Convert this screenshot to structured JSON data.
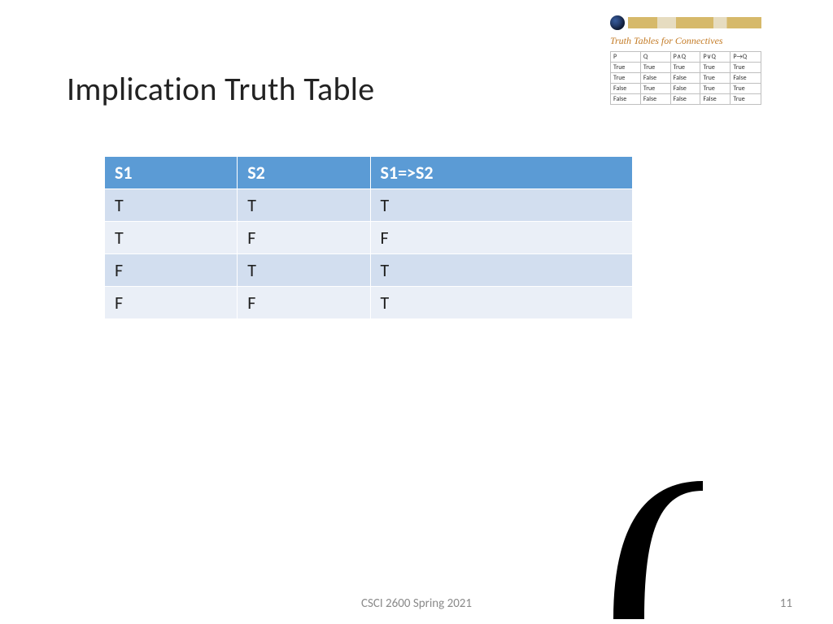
{
  "title": "Implication Truth Table",
  "main_table": {
    "headers": [
      "S1",
      "S2",
      "S1=>S2"
    ],
    "rows": [
      [
        "T",
        "T",
        "T"
      ],
      [
        "T",
        "F",
        "F"
      ],
      [
        "F",
        "T",
        "T"
      ],
      [
        "F",
        "F",
        "T"
      ]
    ]
  },
  "ref": {
    "title": "Truth Tables for Connectives",
    "headers": [
      "P",
      "Q",
      "P∧Q",
      "P∨Q",
      "P→Q"
    ],
    "rows": [
      [
        "True",
        "True",
        "True",
        "True",
        "True"
      ],
      [
        "True",
        "False",
        "False",
        "True",
        "False"
      ],
      [
        "False",
        "True",
        "False",
        "True",
        "True"
      ],
      [
        "False",
        "False",
        "False",
        "False",
        "True"
      ]
    ]
  },
  "footer": "CSCI 2600 Spring 2021",
  "page": "11",
  "chart_data": {
    "type": "table",
    "title": "Implication Truth Table",
    "columns": [
      "S1",
      "S2",
      "S1=>S2"
    ],
    "rows": [
      {
        "S1": "T",
        "S2": "T",
        "S1=>S2": "T"
      },
      {
        "S1": "T",
        "S2": "F",
        "S1=>S2": "F"
      },
      {
        "S1": "F",
        "S2": "T",
        "S1=>S2": "T"
      },
      {
        "S1": "F",
        "S2": "F",
        "S1=>S2": "T"
      }
    ]
  }
}
